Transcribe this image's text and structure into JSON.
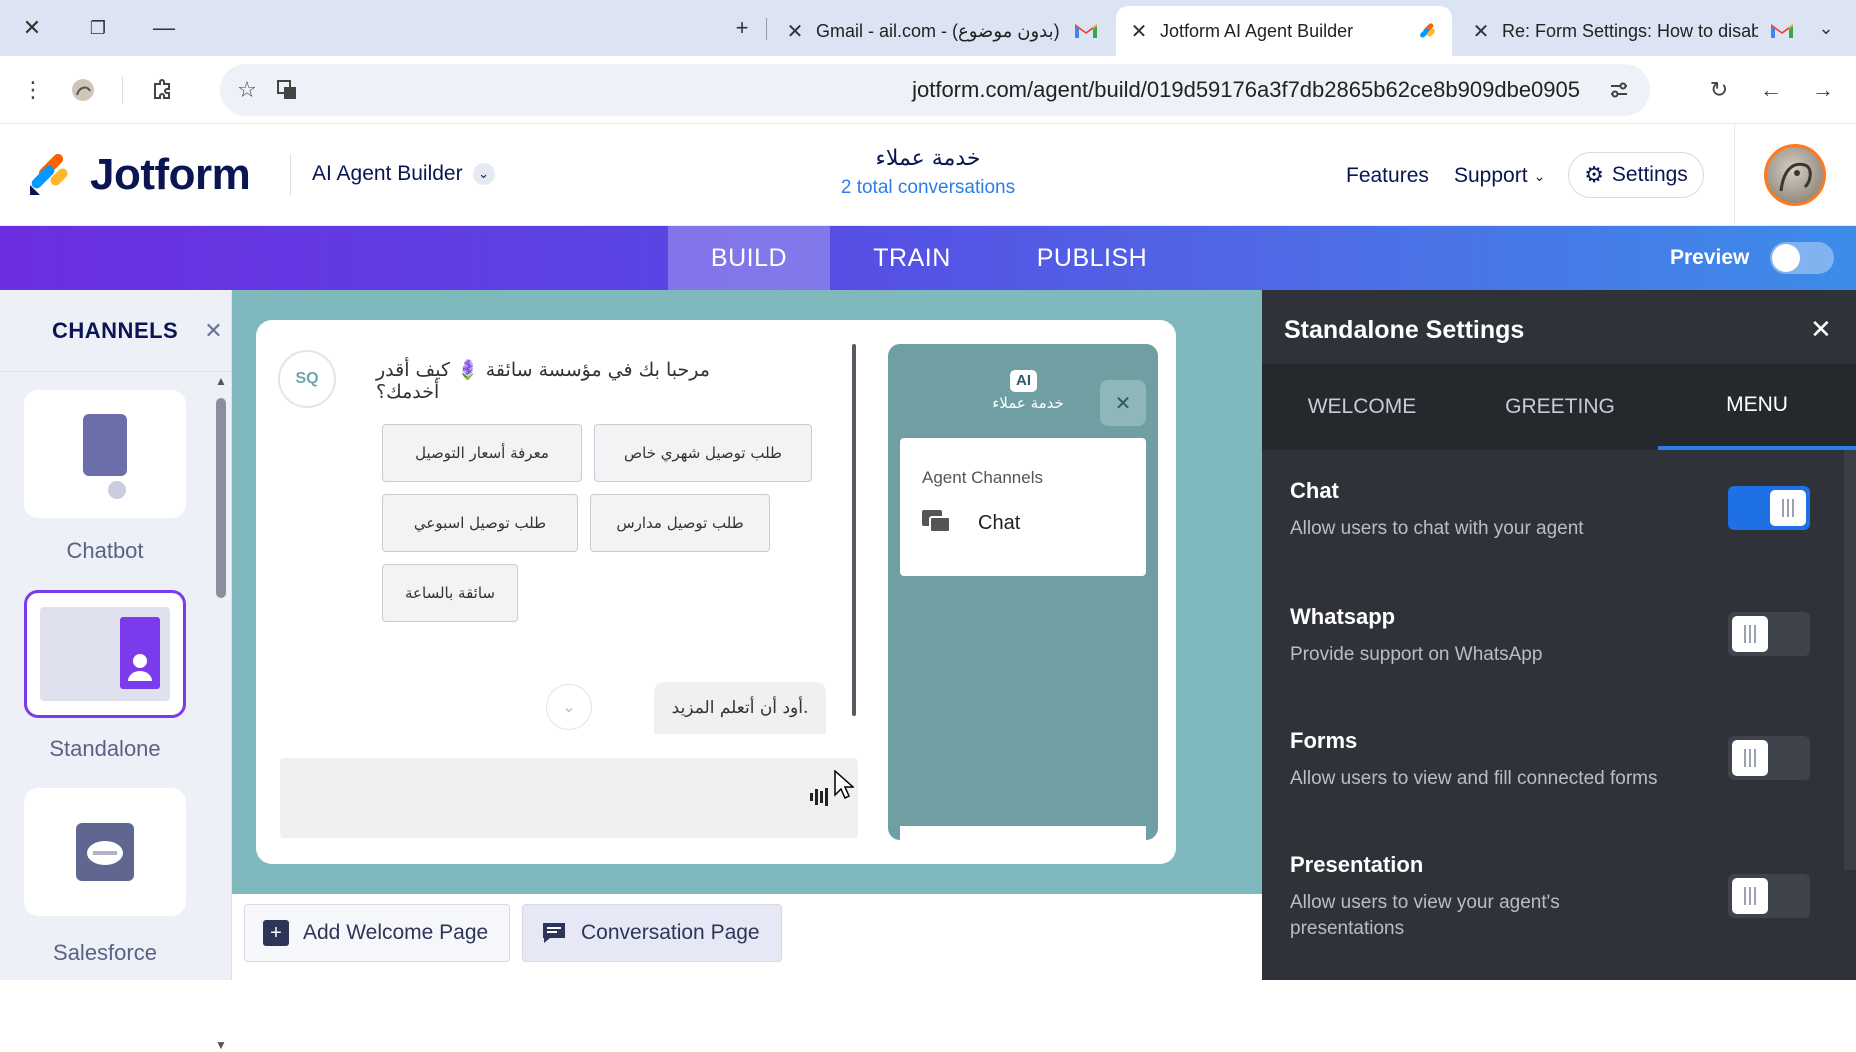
{
  "browser": {
    "tabs": [
      {
        "title": "(بدون موضوع) - Gmail - ail.com",
        "icon": "gmail-icon"
      },
      {
        "title": "Jotform AI Agent Builder",
        "icon": "jotform-favicon-icon",
        "active": true
      },
      {
        "title": "Re: Form Settings: How to disab",
        "icon": "gmail-icon"
      }
    ],
    "url": "jotform.com/agent/build/019d59176a3f7db2865b62ce8b909dbe0905"
  },
  "header": {
    "logo_text": "Jotform",
    "product": "AI Agent Builder",
    "agent_name": "خدمة عملاء",
    "conversations": "2 total conversations",
    "features": "Features",
    "support": "Support",
    "settings": "Settings"
  },
  "nav": {
    "tabs": [
      "BUILD",
      "TRAIN",
      "PUBLISH"
    ],
    "active": "BUILD",
    "preview_label": "Preview",
    "preview_on": false
  },
  "sidebar": {
    "title": "CHANNELS",
    "items": [
      {
        "label": "Chatbot"
      },
      {
        "label": "Standalone",
        "selected": true
      },
      {
        "label": "Salesforce"
      }
    ]
  },
  "chat": {
    "avatar_text": "SQ",
    "greeting": "مرحبا بك في مؤسسة سائقة 🪻 كيف أقدر أخدمك؟",
    "choices": [
      "طلب توصيل شهري خاص",
      "معرفة أسعار التوصيل",
      "طلب توصيل مدارس",
      "طلب توصيل اسبوعي",
      "سائقة بالساعة"
    ],
    "user_message": ".أود أن أتعلم المزيد",
    "input_placeholder": ""
  },
  "mini_panel": {
    "badge": "AI",
    "agent_name": "خدمة عملاء",
    "section_title": "Agent Channels",
    "channel": "Chat"
  },
  "bottom": {
    "add_welcome": "Add Welcome Page",
    "conversation": "Conversation Page"
  },
  "settings_panel": {
    "title": "Standalone Settings",
    "tabs": [
      "WELCOME",
      "GREETING",
      "MENU"
    ],
    "active_tab": "MENU",
    "rows": [
      {
        "title": "Chat",
        "desc": "Allow users to chat with your agent",
        "on": true
      },
      {
        "title": "Whatsapp",
        "desc": "Provide support on WhatsApp",
        "on": false
      },
      {
        "title": "Forms",
        "desc": "Allow users to view and fill connected forms",
        "on": false
      },
      {
        "title": "Presentation",
        "desc": "Allow users to view your agent's presentations",
        "on": false
      }
    ]
  },
  "colors": {
    "brand_navy": "#0a1551",
    "accent_blue": "#1f6fe5",
    "panel_bg": "#2f3238",
    "canvas_bg": "#7fb8bd",
    "sidebar_purple": "#7c3aed"
  }
}
